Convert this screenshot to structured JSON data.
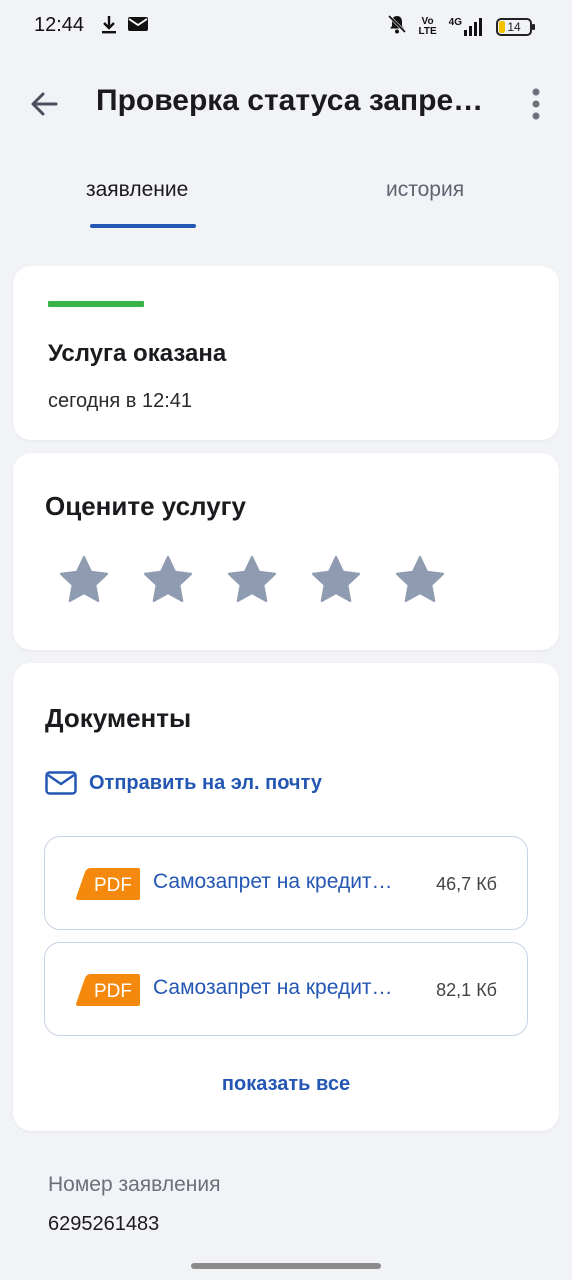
{
  "status_bar": {
    "time": "12:44",
    "volte_top": "Vo",
    "volte_bottom": "LTE",
    "network": "4G",
    "battery": "14"
  },
  "header": {
    "title": "Проверка статуса запре…"
  },
  "tabs": [
    {
      "label": "заявление",
      "active": true
    },
    {
      "label": "история",
      "active": false
    }
  ],
  "status_card": {
    "title": "Услуга оказана",
    "time": "сегодня в 12:41",
    "accent_color": "#38b449"
  },
  "rating_card": {
    "title": "Оцените услугу",
    "star_count": 5,
    "star_color": "#8e9bb0"
  },
  "documents_card": {
    "title": "Документы",
    "email_link": "Отправить на эл. почту",
    "files": [
      {
        "badge": "PDF",
        "name": "Самозапрет на кредит…",
        "size": "46,7 Кб"
      },
      {
        "badge": "PDF",
        "name": "Самозапрет на кредит…",
        "size": "82,1 Кб"
      }
    ],
    "show_all": "показать все"
  },
  "application": {
    "number_label": "Номер заявления",
    "number": "6295261483"
  },
  "colors": {
    "accent": "#2456b3",
    "pdf_badge": "#f5890d",
    "background": "#f1f3f6"
  }
}
